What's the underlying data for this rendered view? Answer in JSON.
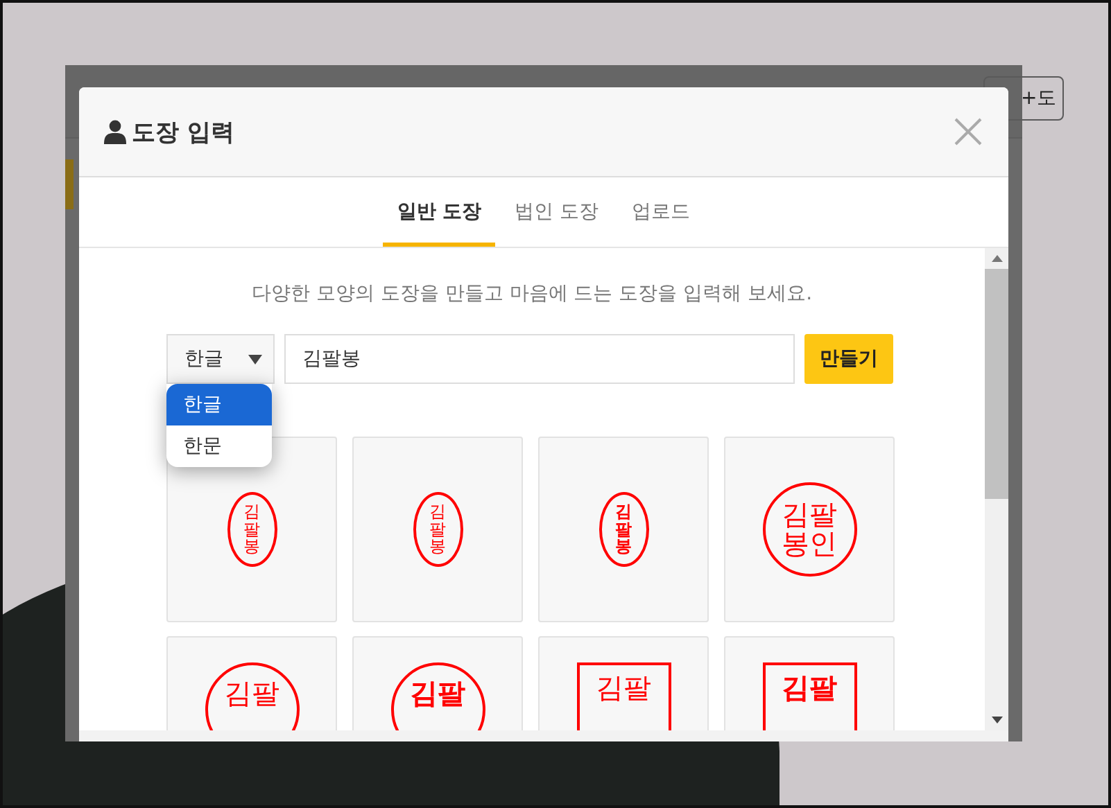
{
  "backdrop": {
    "button": "+도"
  },
  "dialog": {
    "title": "도장 입력"
  },
  "tabs": [
    {
      "label": "일반 도장",
      "selected": true
    },
    {
      "label": "법인 도장",
      "selected": false
    },
    {
      "label": "업로드",
      "selected": false
    }
  ],
  "description": "다양한 모양의 도장을 만들고 마음에 드는 도장을 입력해 보세요.",
  "script_select": {
    "value": "한글",
    "expanded": true,
    "options": [
      {
        "label": "한글",
        "selected": true
      },
      {
        "label": "한문",
        "selected": false
      }
    ]
  },
  "name_field": {
    "value": "김팔봉"
  },
  "create_button": "만들기",
  "stamps": [
    {
      "kind": "oval",
      "bold": false,
      "lines": [
        "김",
        "팔",
        "봉"
      ]
    },
    {
      "kind": "oval",
      "bold": false,
      "lines": [
        "김",
        "팔",
        "봉"
      ]
    },
    {
      "kind": "oval",
      "bold": true,
      "lines": [
        "김",
        "팔",
        "봉"
      ]
    },
    {
      "kind": "circle",
      "bold": false,
      "lines": [
        "김팔",
        "봉인"
      ]
    },
    {
      "kind": "circle",
      "bold": false,
      "lines": [
        "김팔"
      ]
    },
    {
      "kind": "circle",
      "bold": true,
      "lines": [
        "김팔"
      ]
    },
    {
      "kind": "square",
      "bold": false,
      "lines": [
        "김팔"
      ]
    },
    {
      "kind": "square",
      "bold": true,
      "lines": [
        "김팔"
      ]
    }
  ]
}
